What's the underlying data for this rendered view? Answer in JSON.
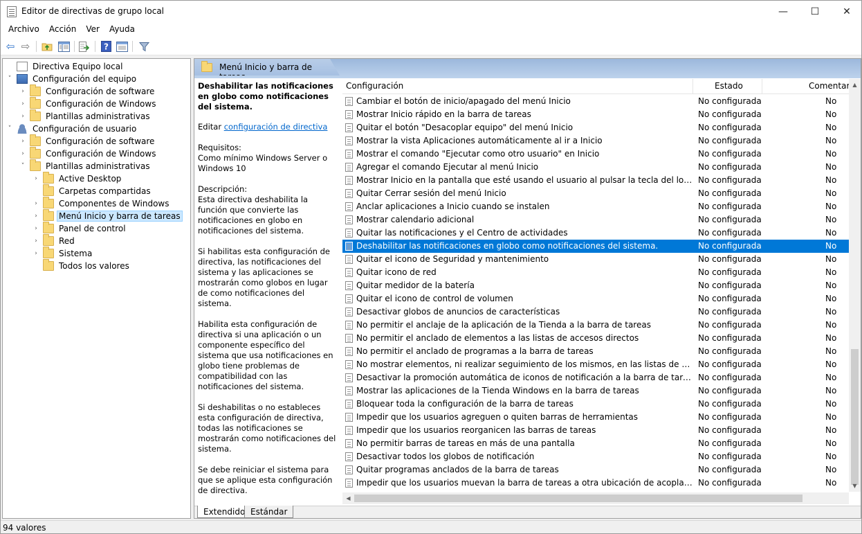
{
  "window": {
    "title": "Editor de directivas de grupo local",
    "minimize": "—",
    "maximize": "☐",
    "close": "✕"
  },
  "menu": [
    "Archivo",
    "Acción",
    "Ver",
    "Ayuda"
  ],
  "toolbar_icons": [
    "back-icon",
    "forward-icon",
    "up-folder-icon",
    "show-hide-tree-icon",
    "export-list-icon",
    "help-icon",
    "properties-icon",
    "filter-icon"
  ],
  "tree": [
    {
      "label": "Directiva Equipo local",
      "icon": "page",
      "exp": ""
    },
    {
      "label": "Configuración del equipo",
      "icon": "computer",
      "exp": "˅"
    },
    {
      "label": "Configuración de software",
      "icon": "folder",
      "exp": "›"
    },
    {
      "label": "Configuración de Windows",
      "icon": "folder",
      "exp": "›"
    },
    {
      "label": "Plantillas administrativas",
      "icon": "folder",
      "exp": "›"
    },
    {
      "label": "Configuración de usuario",
      "icon": "user",
      "exp": "˅"
    },
    {
      "label": "Configuración de software",
      "icon": "folder",
      "exp": "›"
    },
    {
      "label": "Configuración de Windows",
      "icon": "folder",
      "exp": "›"
    },
    {
      "label": "Plantillas administrativas",
      "icon": "folder",
      "exp": "˅"
    },
    {
      "label": "Active Desktop",
      "icon": "folder",
      "exp": "›"
    },
    {
      "label": "Carpetas compartidas",
      "icon": "folder",
      "exp": ""
    },
    {
      "label": "Componentes de Windows",
      "icon": "folder",
      "exp": "›"
    },
    {
      "label": "Menú Inicio y barra de tareas",
      "icon": "folder",
      "exp": "›",
      "selected": true
    },
    {
      "label": "Panel de control",
      "icon": "folder",
      "exp": "›"
    },
    {
      "label": "Red",
      "icon": "folder",
      "exp": "›"
    },
    {
      "label": "Sistema",
      "icon": "folder",
      "exp": "›"
    },
    {
      "label": "Todos los valores",
      "icon": "folder-page",
      "exp": ""
    }
  ],
  "pane_header": "Menú Inicio y barra de tareas",
  "description": {
    "title": "Deshabilitar las notificaciones en globo como notificaciones del sistema.",
    "edit_prefix": "Editar",
    "edit_link": "configuración de directiva",
    "req_label": "Requisitos:",
    "req_text": "Como mínimo Windows Server o Windows 10",
    "desc_label": "Descripción:",
    "p1": "Esta directiva deshabilita la función que convierte las notificaciones en globo en notificaciones del sistema.",
    "p2": "Si habilitas esta configuración de directiva, las notificaciones del sistema y las aplicaciones se mostrarán como globos en lugar de como notificaciones del sistema.",
    "p3": "Habilita esta configuración de directiva si una aplicación o un componente específico del sistema que usa notificaciones en globo tiene problemas de compatibilidad con las notificaciones del sistema.",
    "p4": "Si deshabilitas o no estableces esta configuración de directiva, todas las notificaciones se mostrarán como notificaciones del sistema.",
    "p5": "Se debe reiniciar el sistema para que se aplique esta configuración de directiva."
  },
  "columns": {
    "c1": "Configuración",
    "c2": "Estado",
    "c3": "Comentario"
  },
  "rows": [
    {
      "name": "Cambiar el botón de inicio/apagado del menú Inicio",
      "state": "No configurada",
      "comment": "No"
    },
    {
      "name": "Mostrar Inicio rápido en la barra de tareas",
      "state": "No configurada",
      "comment": "No"
    },
    {
      "name": "Quitar el botón \"Desacoplar equipo\" del menú Inicio",
      "state": "No configurada",
      "comment": "No"
    },
    {
      "name": "Mostrar la vista Aplicaciones automáticamente al ir a Inicio",
      "state": "No configurada",
      "comment": "No"
    },
    {
      "name": "Mostrar el comando \"Ejecutar como otro usuario\" en Inicio",
      "state": "No configurada",
      "comment": "No"
    },
    {
      "name": "Agregar el comando Ejecutar al menú Inicio",
      "state": "No configurada",
      "comment": "No"
    },
    {
      "name": "Mostrar Inicio en la pantalla que esté usando el usuario al pulsar la tecla del logotipo de W...",
      "state": "No configurada",
      "comment": "No"
    },
    {
      "name": "Quitar Cerrar sesión del menú Inicio",
      "state": "No configurada",
      "comment": "No"
    },
    {
      "name": "Anclar aplicaciones a Inicio cuando se instalen",
      "state": "No configurada",
      "comment": "No"
    },
    {
      "name": "Mostrar calendario adicional",
      "state": "No configurada",
      "comment": "No"
    },
    {
      "name": "Quitar las notificaciones y el Centro de actividades",
      "state": "No configurada",
      "comment": "No"
    },
    {
      "name": "Deshabilitar las notificaciones en globo como notificaciones del sistema.",
      "state": "No configurada",
      "comment": "No",
      "selected": true
    },
    {
      "name": "Quitar el icono de Seguridad y mantenimiento",
      "state": "No configurada",
      "comment": "No"
    },
    {
      "name": "Quitar icono de red",
      "state": "No configurada",
      "comment": "No"
    },
    {
      "name": "Quitar medidor de la batería",
      "state": "No configurada",
      "comment": "No"
    },
    {
      "name": "Quitar el icono de control de volumen",
      "state": "No configurada",
      "comment": "No"
    },
    {
      "name": "Desactivar globos de anuncios de características",
      "state": "No configurada",
      "comment": "No"
    },
    {
      "name": "No permitir el anclaje de la aplicación de la Tienda a la barra de tareas",
      "state": "No configurada",
      "comment": "No"
    },
    {
      "name": "No permitir el anclado de elementos a las listas de accesos directos",
      "state": "No configurada",
      "comment": "No"
    },
    {
      "name": "No permitir el anclado de programas a la barra de tareas",
      "state": "No configurada",
      "comment": "No"
    },
    {
      "name": "No mostrar elementos, ni realizar seguimiento de los mismos, en las listas de accesos dire...",
      "state": "No configurada",
      "comment": "No"
    },
    {
      "name": "Desactivar la promoción automática de iconos de notificación a la barra de tareas",
      "state": "No configurada",
      "comment": "No"
    },
    {
      "name": "Mostrar las aplicaciones de la Tienda Windows en la barra de tareas",
      "state": "No configurada",
      "comment": "No"
    },
    {
      "name": "Bloquear toda la configuración de la barra de tareas",
      "state": "No configurada",
      "comment": "No"
    },
    {
      "name": "Impedir que los usuarios agreguen o quiten barras de herramientas",
      "state": "No configurada",
      "comment": "No"
    },
    {
      "name": "Impedir que los usuarios reorganicen las barras de tareas",
      "state": "No configurada",
      "comment": "No"
    },
    {
      "name": "No permitir barras de tareas en más de una pantalla",
      "state": "No configurada",
      "comment": "No"
    },
    {
      "name": "Desactivar todos los globos de notificación",
      "state": "No configurada",
      "comment": "No"
    },
    {
      "name": "Quitar programas anclados de la barra de tareas",
      "state": "No configurada",
      "comment": "No"
    },
    {
      "name": "Impedir que los usuarios muevan la barra de tareas a otra ubicación de acoplamiento de la...",
      "state": "No configurada",
      "comment": "No"
    }
  ],
  "tabs": [
    "Extendido",
    "Estándar"
  ],
  "status": "94 valores"
}
